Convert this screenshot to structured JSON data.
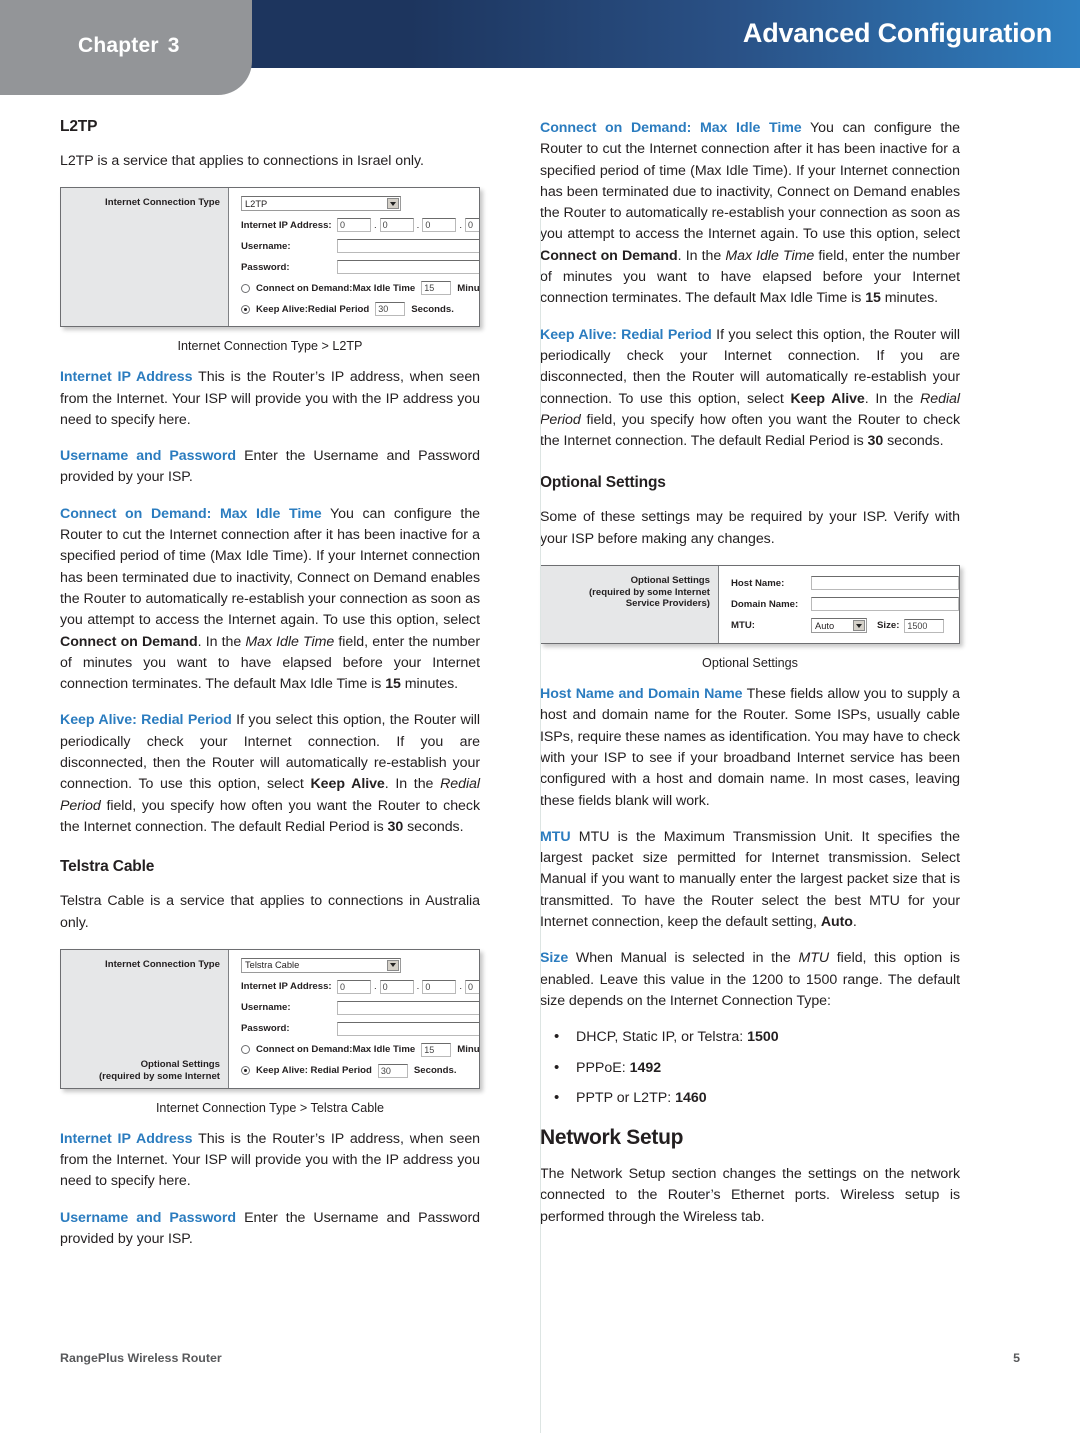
{
  "header": {
    "chapter_word": "Chapter",
    "chapter_number": "3",
    "title": "Advanced Configuration"
  },
  "left_column": {
    "heading_l2tp": "L2TP",
    "intro_l2tp": "L2TP is a service that applies to connections in Israel only.",
    "figure_l2tp": {
      "caption": "Internet Connection Type > L2TP",
      "panel_label": "Internet Connection Type",
      "connection_type_value": "L2TP",
      "ip_label": "Internet IP Address:",
      "ip_octets": [
        "0",
        "0",
        "0",
        "0"
      ],
      "username_label": "Username:",
      "username_value": "",
      "password_label": "Password:",
      "password_value": "",
      "connect_on_demand_label": "Connect on Demand:Max Idle Time",
      "max_idle_value": "15",
      "minutes_unit": "Minutes.",
      "keep_alive_label": "Keep Alive:Redial Period",
      "redial_value": "30",
      "seconds_unit": "Seconds."
    },
    "internet_ip_term": "Internet IP Address",
    "internet_ip_body": " This is the Router’s IP address, when seen from the Internet. Your ISP will provide you with the IP address you need to specify here.",
    "username_password_term": "Username and Password",
    "username_password_body": " Enter the Username and Password provided by your ISP.",
    "cod_term": "Connect on Demand: Max Idle Time",
    "cod_p1": " You can configure the Router to cut the Internet connection after it has been inactive for a specified period of time (Max Idle Time). If your Internet connection has been terminated due to inactivity, Connect on Demand enables the Router to automatically re-establish your connection as soon as you attempt to access the Internet again. To use this option, select ",
    "cod_bold1": "Connect on Demand",
    "cod_p2": ". In the ",
    "cod_ital1": "Max Idle Time",
    "cod_p3": " field, enter the number of minutes you want to have elapsed before your Internet connection terminates. The default Max Idle Time is ",
    "cod_bold2": "15",
    "cod_p4": " minutes.",
    "keep_term": "Keep Alive: Redial Period",
    "keep_p1": " If you select this option, the Router will periodically check your Internet connection. If you are disconnected, then the Router will automatically re-establish your connection. To use this option, select ",
    "keep_bold1": "Keep Alive",
    "keep_p2": ". In the ",
    "keep_ital1": "Redial Period",
    "keep_p3": " field, you specify how often you want the Router to check the Internet connection. The default Redial Period is ",
    "keep_bold2": "30",
    "keep_p4": " seconds.",
    "heading_telstra": "Telstra Cable",
    "intro_telstra": "Telstra Cable is a service that applies to connections in Australia only.",
    "figure_telstra": {
      "caption": "Internet Connection Type > Telstra Cable",
      "panel_label": "Internet Connection Type",
      "panel_label_2": "Optional Settings",
      "panel_label_3": "(required by some Internet",
      "connection_type_value": "Telstra Cable",
      "ip_label": "Internet IP Address:",
      "ip_octets": [
        "0",
        "0",
        "0",
        "0"
      ],
      "username_label": "Username:",
      "password_label": "Password:",
      "connect_on_demand_label": "Connect on Demand:Max Idle Time",
      "max_idle_value": "15",
      "minutes_unit": "Minutes.",
      "keep_alive_label": "Keep Alive: Redial Period",
      "redial_value": "30",
      "seconds_unit": "Seconds."
    },
    "internet_ip_term_2": "Internet IP Address",
    "internet_ip_body_2": " This is the Router’s IP address, when seen from the Internet. Your ISP will provide you with the IP address you need to specify here.",
    "username_password_term_2": "Username and Password",
    "username_password_body_2": " Enter the Username and Password provided by your ISP."
  },
  "right_column": {
    "cod_term": "Connect on Demand: Max Idle Time",
    "cod_p1": " You can configure the Router to cut the Internet connection after it has been inactive for a specified period of time (Max Idle Time). If your Internet connection has been terminated due to inactivity, Connect on Demand enables the Router to automatically re-establish your connection as soon as you attempt to access the Internet again. To use this option, select ",
    "cod_bold1": "Connect on Demand",
    "cod_p2": ". In the ",
    "cod_ital1": "Max Idle Time",
    "cod_p3": " field, enter the number of minutes you want to have elapsed before your Internet connection terminates. The default Max Idle Time is ",
    "cod_bold2": "15",
    "cod_p4": " minutes.",
    "keep_term": "Keep Alive: Redial Period",
    "keep_p1": " If you select this option, the Router will periodically check your Internet connection. If you are disconnected, then the Router will automatically re-establish your connection. To use this option, select ",
    "keep_bold1": "Keep Alive",
    "keep_p2": ". In the ",
    "keep_ital1": "Redial Period",
    "keep_p3": " field, you specify how often you want the Router to check the Internet connection. The default Redial Period is ",
    "keep_bold2": "30",
    "keep_p4": " seconds.",
    "heading_optional": "Optional Settings",
    "intro_optional": "Some of these settings may be required by your ISP. Verify with your ISP before making any changes.",
    "figure_optional": {
      "caption": "Optional Settings",
      "panel_label_1": "Optional Settings",
      "panel_label_2": "(required by some Internet",
      "panel_label_3": "Service Providers)",
      "host_name_label": "Host Name:",
      "host_name_value": "",
      "domain_name_label": "Domain Name:",
      "domain_name_value": "",
      "mtu_label": "MTU:",
      "mtu_value": "Auto",
      "size_label": "Size:",
      "size_value": "1500"
    },
    "host_term": "Host Name and Domain Name",
    "host_body": " These fields allow you to supply a host and domain name for the Router. Some ISPs, usually cable ISPs, require these names as identification. You may have to check with your ISP to see if your broadband Internet service has been configured with a host and domain name. In most cases, leaving these fields blank will work.",
    "mtu_term": "MTU",
    "mtu_p1": " MTU is the Maximum Transmission Unit. It specifies the largest packet size permitted for Internet transmission. Select Manual if you want to manually enter the largest packet size that is transmitted. To have the Router select the best MTU for your Internet connection, keep the default setting, ",
    "mtu_bold1": "Auto",
    "mtu_p2": ".",
    "size_term": "Size",
    "size_p1": " When Manual is selected in the ",
    "size_ital1": "MTU",
    "size_p2": " field, this option is enabled. Leave this value in the 1200 to 1500 range. The default size depends on the Internet Connection Type:",
    "bullets": [
      {
        "text": "DHCP, Static IP, or Telstra: ",
        "value": "1500"
      },
      {
        "text": "PPPoE: ",
        "value": "1492"
      },
      {
        "text": "PPTP or L2TP: ",
        "value": "1460"
      }
    ],
    "heading_network_setup": "Network Setup",
    "network_setup_body": "The Network Setup section changes the settings on the network connected to the Router’s Ethernet ports. Wireless setup is performed through the Wireless tab."
  },
  "footer": {
    "product": "RangePlus Wireless Router",
    "page_number": "5"
  },
  "colors": {
    "term_blue": "#2b7cbf",
    "header_navy": "#1d355e",
    "header_blue": "#2f7fc0",
    "tab_gray": "#939598"
  }
}
